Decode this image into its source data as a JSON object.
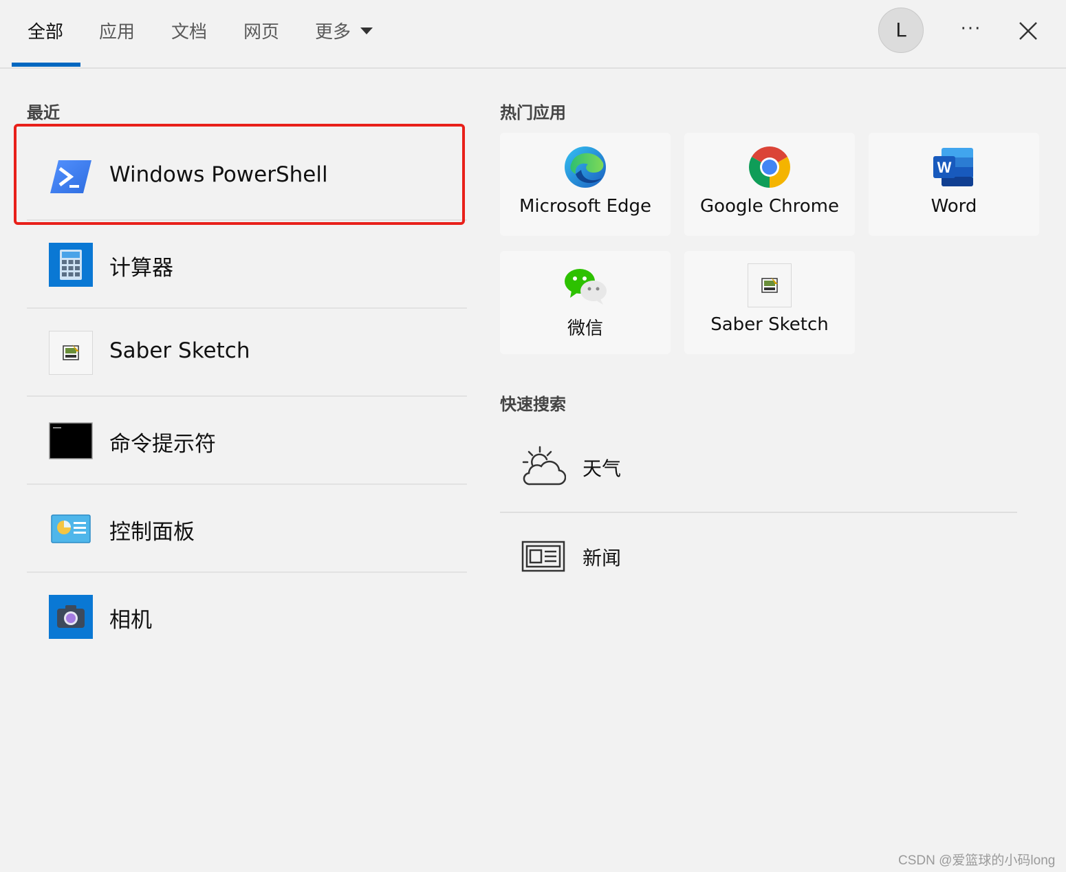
{
  "tabs": [
    {
      "label": "全部",
      "active": true
    },
    {
      "label": "应用"
    },
    {
      "label": "文档"
    },
    {
      "label": "网页"
    },
    {
      "label": "更多"
    }
  ],
  "account": {
    "initial": "L"
  },
  "more_label": "···",
  "recent": {
    "title": "最近",
    "items": [
      {
        "label": "Windows PowerShell",
        "icon": "powershell-icon",
        "highlighted": true
      },
      {
        "label": "计算器",
        "icon": "calculator-icon"
      },
      {
        "label": "Saber Sketch",
        "icon": "saber-sketch-icon"
      },
      {
        "label": "命令提示符",
        "icon": "command-prompt-icon"
      },
      {
        "label": "控制面板",
        "icon": "control-panel-icon"
      },
      {
        "label": "相机",
        "icon": "camera-icon"
      }
    ]
  },
  "top_apps": {
    "title": "热门应用",
    "items": [
      {
        "label": "Microsoft Edge",
        "icon": "edge-icon"
      },
      {
        "label": "Google Chrome",
        "icon": "chrome-icon"
      },
      {
        "label": "Word",
        "icon": "word-icon"
      },
      {
        "label": "微信",
        "icon": "wechat-icon"
      },
      {
        "label": "Saber Sketch",
        "icon": "saber-sketch-icon"
      }
    ]
  },
  "quick_search": {
    "title": "快速搜索",
    "items": [
      {
        "label": "天气",
        "icon": "weather-icon"
      },
      {
        "label": "新闻",
        "icon": "news-icon"
      }
    ]
  },
  "colors": {
    "accent": "#0067c0",
    "highlight_border": "#e8201a"
  },
  "watermark": "CSDN @爱篮球的小码long"
}
